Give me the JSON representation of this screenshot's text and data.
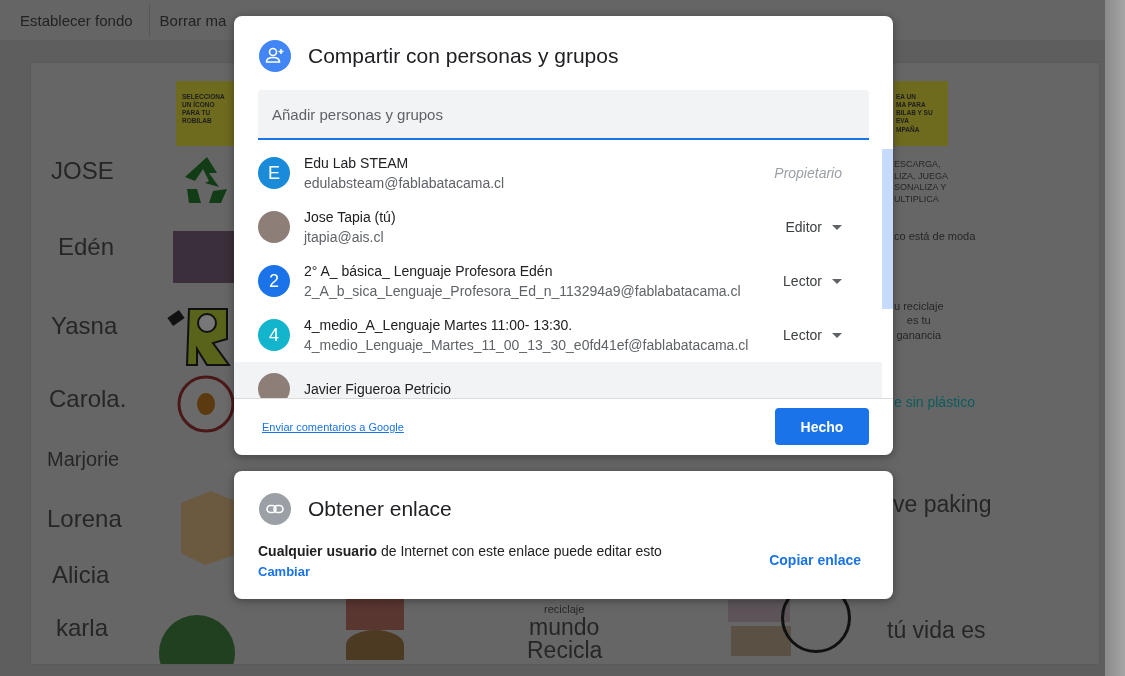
{
  "toolbar": {
    "buttons": [
      "Establecer fondo",
      "Borrar ma"
    ]
  },
  "slide": {
    "names": [
      "JOSE",
      "Edén",
      "Yasna",
      "Carola.",
      "Marjorie",
      "Lorena",
      "Alicia",
      "karla"
    ],
    "left_note": [
      "SELECCIONA",
      "UN ÍCONO",
      "PARA TU",
      "ROBILAB"
    ],
    "right_note": [
      "EA UN",
      "MA PARA",
      "BILAB Y SU",
      "EVA",
      "MPAÑA"
    ],
    "texts": [
      {
        "kind": "small",
        "lines": [
          "ESCARGA,",
          "LIZA, JUEGA",
          "SONALIZA Y",
          "ULTIPLICA"
        ]
      },
      {
        "kind": "caption",
        "lines": [
          "co está de moda"
        ]
      },
      {
        "kind": "caption",
        "lines": [
          "u reciclaje",
          "es tu",
          "ganancia"
        ]
      },
      {
        "kind": "link",
        "lines": [
          "e sin plástico"
        ]
      },
      {
        "kind": "large",
        "lines": [
          "ve paking"
        ]
      },
      {
        "kind": "large",
        "lines": [
          "tú vida es"
        ]
      },
      {
        "kind": "caption",
        "lines": [
          "reciclaje"
        ]
      },
      {
        "kind": "large",
        "lines": [
          "mundo"
        ]
      },
      {
        "kind": "large",
        "lines": [
          "Recicla"
        ]
      }
    ]
  },
  "share_dialog": {
    "title": "Compartir con personas y grupos",
    "search": {
      "placeholder": "Añadir personas y grupos"
    },
    "people": [
      {
        "name": "Edu Lab STEAM",
        "email": "edulabsteam@fablabatacama.cl",
        "avatar": {
          "kind": "letter",
          "letter": "E",
          "color": "#1a8bd8"
        },
        "role": {
          "kind": "owner",
          "label": "Propietario"
        },
        "selected": false
      },
      {
        "name": "Jose Tapia (tú)",
        "email": "jtapia@ais.cl",
        "avatar": {
          "kind": "photo"
        },
        "role": {
          "kind": "menu",
          "label": "Editor"
        },
        "selected": false
      },
      {
        "name": "2° A_ básica_ Lenguaje Profesora Edén",
        "email": "2_A_b_sica_Lenguaje_Profesora_Ed_n_113294a9@fablabatacama.cl",
        "avatar": {
          "kind": "letter",
          "letter": "2",
          "color": "#1a73e8"
        },
        "role": {
          "kind": "menu",
          "label": "Lector"
        },
        "selected": false
      },
      {
        "name": "4_medio_A_Lenguaje Martes 11:00- 13:30.",
        "email": "4_medio_Lenguaje_Martes_11_00_13_30_e0fd41ef@fablabatacama.cl",
        "avatar": {
          "kind": "letter",
          "letter": "4",
          "color": "#12b5cb"
        },
        "role": {
          "kind": "menu",
          "label": "Lector"
        },
        "selected": false
      },
      {
        "name": "Javier Figueroa Petricio",
        "avatar": {
          "kind": "photo"
        },
        "selected": true
      }
    ],
    "feedback_link": "Enviar comentarios a Google",
    "done_button": "Hecho"
  },
  "link_dialog": {
    "title": "Obtener enlace",
    "description": "**Cualquier usuario** de Internet con este enlace puede editar esto",
    "change_link": "Cambiar",
    "copy_link": "Copiar enlace"
  }
}
